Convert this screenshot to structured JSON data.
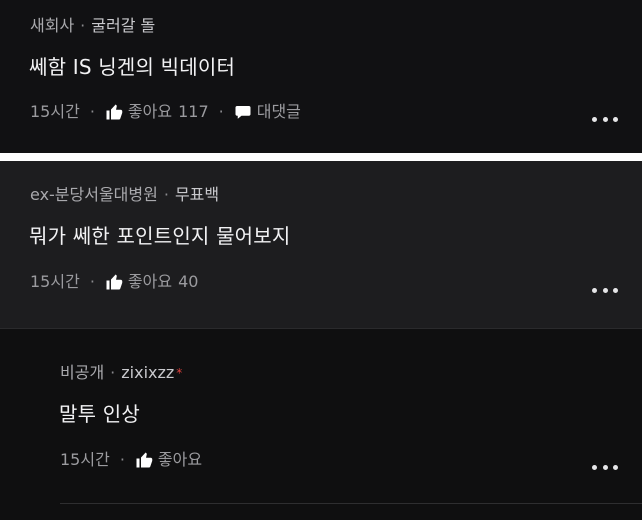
{
  "posts": [
    {
      "company": "새회사",
      "author": "굴러갈 돌",
      "title": "쎄함 IS 닝겐의 빅데이터",
      "time": "15시간",
      "like_label": "좋아요",
      "like_count": "117",
      "comment_label": "대댓글"
    },
    {
      "company": "ex-분당서울대병원",
      "author": "무표백",
      "title": "뭐가 쎄한 포인트인지 물어보지",
      "time": "15시간",
      "like_label": "좋아요",
      "like_count": "40"
    },
    {
      "company": "비공개",
      "author": "zixixzz",
      "author_mark": "*",
      "title": "말투 인상",
      "time": "15시간",
      "like_label": "좋아요"
    }
  ],
  "separator": "·",
  "icons": {
    "like": "thumbs-up-icon",
    "comment": "speech-bubble-icon",
    "more": "more-dots-icon"
  },
  "colors": {
    "background_dark": "#111113",
    "background_mid": "#1d1d1f",
    "text_primary": "#f2f2f4",
    "text_secondary": "#9b9b9f",
    "accent_mark": "#e0413c"
  }
}
